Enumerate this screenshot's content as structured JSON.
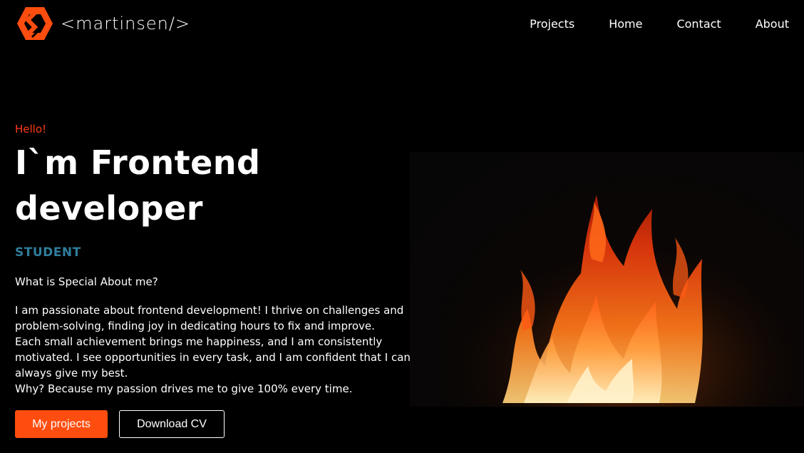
{
  "brand": {
    "logo_icon": "hexagon-logo-icon",
    "name": "<martinsen/>",
    "accent": "#ff4d0f"
  },
  "nav": {
    "items": [
      "Projects",
      "Home",
      "Contact",
      "About"
    ]
  },
  "hero": {
    "greeting": "Hello!",
    "title_line1": "I`m Frontend",
    "title_line2": "developer",
    "subtitle": "STUDENT",
    "question": "What is Special About me?",
    "description": [
      "I am passionate about frontend development! I thrive on challenges and",
      "problem-solving, finding joy in dedicating hours to fix and improve.",
      "Each small achievement brings me happiness, and I am consistently",
      "motivated. I see opportunities in every task, and I am confident that I can",
      "always give my best.",
      "Why? Because my passion drives me to give 100% every time."
    ],
    "buttons": {
      "primary": "My projects",
      "secondary": "Download CV"
    },
    "image": "fire-image"
  },
  "colors": {
    "greeting": "#ff3b1a",
    "subtitle": "#2f7e9c",
    "primary_button": "#ff4d0f",
    "background": "#000000"
  }
}
